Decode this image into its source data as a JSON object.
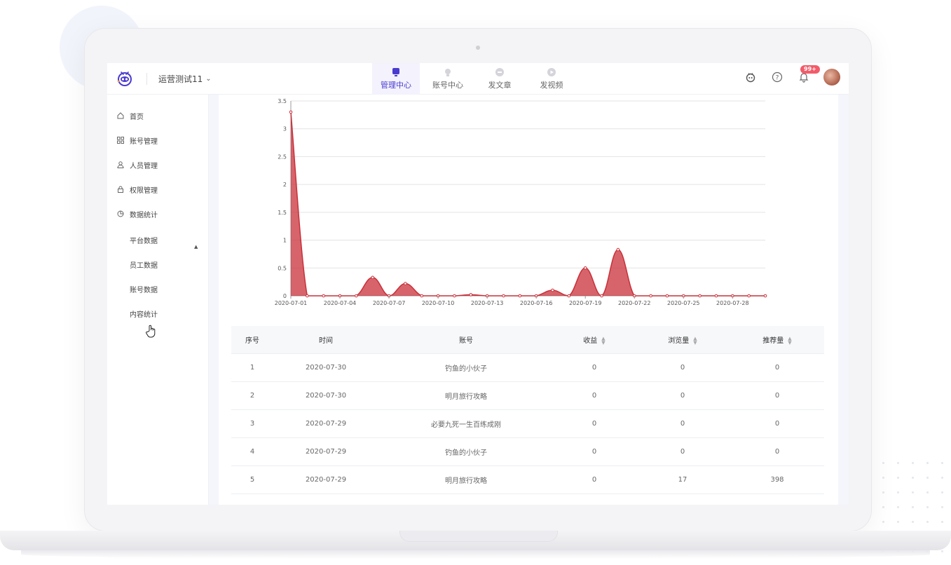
{
  "header": {
    "org_name": "运营测试11",
    "nav_tabs": [
      {
        "label": "管理中心",
        "icon": "monitor-icon",
        "active": true
      },
      {
        "label": "账号中心",
        "icon": "bulb-icon",
        "active": false
      },
      {
        "label": "发文章",
        "icon": "article-icon",
        "active": false
      },
      {
        "label": "发视频",
        "icon": "video-icon",
        "active": false
      }
    ],
    "notification_badge": "99+"
  },
  "sidebar": {
    "items": [
      {
        "label": "首页",
        "icon": "home-icon"
      },
      {
        "label": "账号管理",
        "icon": "grid-icon"
      },
      {
        "label": "人员管理",
        "icon": "user-icon"
      },
      {
        "label": "权限管理",
        "icon": "lock-icon"
      },
      {
        "label": "数据统计",
        "icon": "pie-chart-icon"
      }
    ],
    "sub_items": [
      {
        "label": "平台数据"
      },
      {
        "label": "员工数据"
      },
      {
        "label": "账号数据"
      },
      {
        "label": "内容统计"
      }
    ]
  },
  "chart_data": {
    "type": "area",
    "x": [
      "2020-07-01",
      "2020-07-02",
      "2020-07-03",
      "2020-07-04",
      "2020-07-05",
      "2020-07-06",
      "2020-07-07",
      "2020-07-08",
      "2020-07-09",
      "2020-07-10",
      "2020-07-11",
      "2020-07-12",
      "2020-07-13",
      "2020-07-14",
      "2020-07-15",
      "2020-07-16",
      "2020-07-17",
      "2020-07-18",
      "2020-07-19",
      "2020-07-20",
      "2020-07-21",
      "2020-07-22",
      "2020-07-23",
      "2020-07-24",
      "2020-07-25",
      "2020-07-26",
      "2020-07-27",
      "2020-07-28",
      "2020-07-29",
      "2020-07-30"
    ],
    "x_tick_labels": [
      "2020-07-01",
      "2020-07-04",
      "2020-07-07",
      "2020-07-10",
      "2020-07-13",
      "2020-07-16",
      "2020-07-19",
      "2020-07-22",
      "2020-07-25",
      "2020-07-28"
    ],
    "values": [
      3.3,
      0,
      0,
      0,
      0,
      0.33,
      0,
      0.22,
      0,
      0,
      0,
      0.02,
      0,
      0,
      0,
      0,
      0.1,
      0,
      0.5,
      0,
      0.83,
      0,
      0,
      0,
      0,
      0,
      0,
      0,
      0,
      0
    ],
    "ylim": [
      0,
      3.5
    ],
    "y_ticks": [
      "0",
      "0.5",
      "1",
      "1.5",
      "2",
      "2.5",
      "3",
      "3.5"
    ],
    "color": "#c9303a",
    "grid": true
  },
  "table": {
    "headers": [
      "序号",
      "时间",
      "账号",
      "收益",
      "浏览量",
      "推荐量"
    ],
    "sortable": [
      false,
      false,
      false,
      true,
      true,
      true
    ],
    "rows": [
      [
        "1",
        "2020-07-30",
        "钓鱼的小伙子",
        "0",
        "0",
        "0"
      ],
      [
        "2",
        "2020-07-30",
        "明月旅行攻略",
        "0",
        "0",
        "0"
      ],
      [
        "3",
        "2020-07-29",
        "必要九死一生百练成刚",
        "0",
        "0",
        "0"
      ],
      [
        "4",
        "2020-07-29",
        "钓鱼的小伙子",
        "0",
        "0",
        "0"
      ],
      [
        "5",
        "2020-07-29",
        "明月旅行攻略",
        "0",
        "17",
        "398"
      ]
    ]
  },
  "colors": {
    "accent": "#4a3bcf",
    "badge": "#f25c6a"
  }
}
